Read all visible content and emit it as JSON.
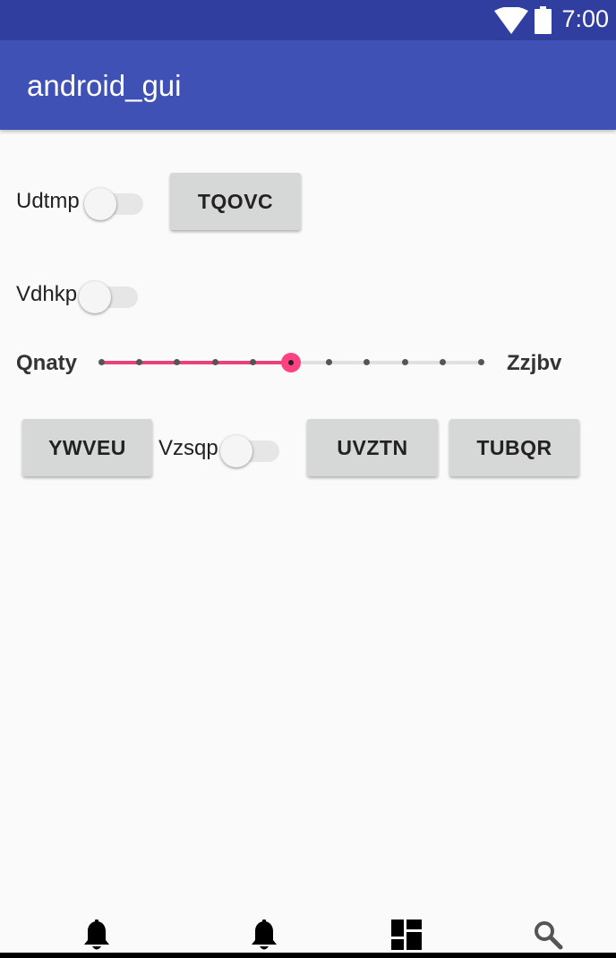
{
  "status_bar": {
    "time": "7:00"
  },
  "app_bar": {
    "title": "android_gui"
  },
  "row1": {
    "switch_label": "Udtmp",
    "switch_on": false,
    "button_label": "TQOVC"
  },
  "row2": {
    "switch_label": "Vdhkp",
    "switch_on": false
  },
  "seek": {
    "min_label": "Qnaty",
    "max_label": "Zzjbv",
    "ticks": 11,
    "value_index": 5
  },
  "row4": {
    "button1_label": "YWVEU",
    "switch_label": "Vzsqp",
    "switch_on": false,
    "button2_label": "UVZTN",
    "button3_label": "TUBQR"
  },
  "bottom_nav": {
    "icons": [
      "bell-icon",
      "bell-icon",
      "dashboard-icon",
      "search-icon"
    ]
  },
  "colors": {
    "status_bar": "#303f9f",
    "app_bar": "#3f51b5",
    "accent": "#ff4081",
    "background": "#fafafa"
  }
}
